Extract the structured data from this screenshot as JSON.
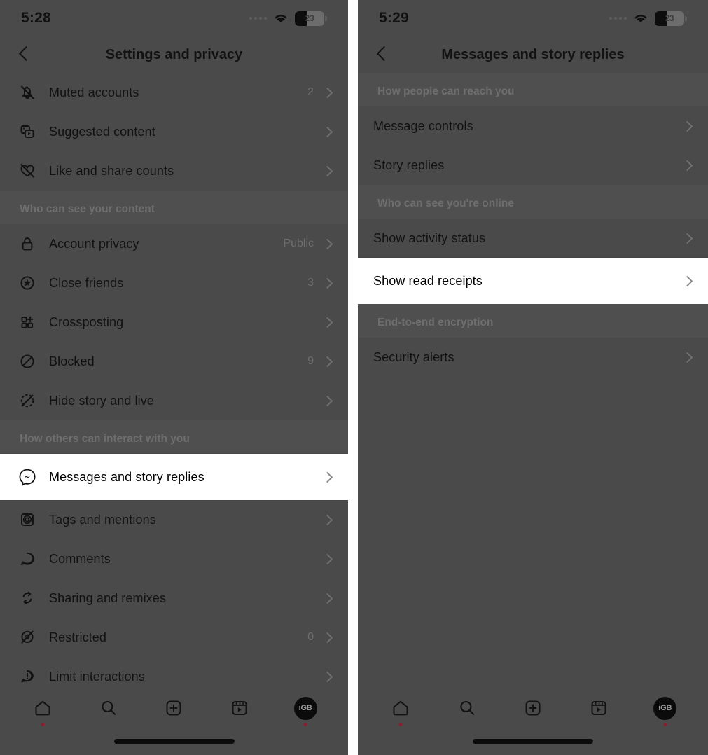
{
  "left_phone": {
    "status_bar": {
      "time": "5:28",
      "battery_level": "23",
      "wifi_icon": "wifi-icon",
      "signal_icon": "signal-dots-icon"
    },
    "header": {
      "back_icon": "back-chevron-icon",
      "title": "Settings and privacy"
    },
    "groups": [
      {
        "header": null,
        "rows": [
          {
            "icon": "muted-bell-icon",
            "label": "Muted accounts",
            "value": "2",
            "highlighted": false
          },
          {
            "icon": "suggested-content-icon",
            "label": "Suggested content",
            "value": "",
            "highlighted": false
          },
          {
            "icon": "heart-slash-icon",
            "label": "Like and share counts",
            "value": "",
            "highlighted": false
          }
        ]
      },
      {
        "header": "Who can see your content",
        "rows": [
          {
            "icon": "lock-icon",
            "label": "Account privacy",
            "value": "Public",
            "highlighted": false
          },
          {
            "icon": "close-friends-star-icon",
            "label": "Close friends",
            "value": "3",
            "highlighted": false
          },
          {
            "icon": "crossposting-grid-icon",
            "label": "Crossposting",
            "value": "",
            "highlighted": false
          },
          {
            "icon": "blocked-circle-slash-icon",
            "label": "Blocked",
            "value": "9",
            "highlighted": false
          },
          {
            "icon": "hide-story-icon",
            "label": "Hide story and live",
            "value": "",
            "highlighted": false
          }
        ]
      },
      {
        "header": "How others can interact with you",
        "rows": [
          {
            "icon": "messenger-icon",
            "label": "Messages and story replies",
            "value": "",
            "highlighted": true
          },
          {
            "icon": "at-mention-icon",
            "label": "Tags and mentions",
            "value": "",
            "highlighted": false
          },
          {
            "icon": "comment-bubble-icon",
            "label": "Comments",
            "value": "",
            "highlighted": false
          },
          {
            "icon": "sharing-remix-icon",
            "label": "Sharing and remixes",
            "value": "",
            "highlighted": false
          },
          {
            "icon": "restricted-icon",
            "label": "Restricted",
            "value": "0",
            "highlighted": false
          },
          {
            "icon": "limit-interactions-icon",
            "label": "Limit interactions",
            "value": "",
            "highlighted": false
          }
        ]
      }
    ],
    "tabbar": {
      "items": [
        {
          "icon": "home-icon",
          "has_dot": true
        },
        {
          "icon": "search-icon",
          "has_dot": false
        },
        {
          "icon": "create-plus-icon",
          "has_dot": false
        },
        {
          "icon": "reels-icon",
          "has_dot": false
        },
        {
          "icon": "profile-avatar",
          "has_dot": true,
          "avatar_text": "iGB"
        }
      ]
    }
  },
  "right_phone": {
    "status_bar": {
      "time": "5:29",
      "battery_level": "23",
      "wifi_icon": "wifi-icon",
      "signal_icon": "signal-dots-icon"
    },
    "header": {
      "back_icon": "back-chevron-icon",
      "title": "Messages and story replies"
    },
    "groups": [
      {
        "header": "How people can reach you",
        "rows": [
          {
            "label": "Message controls",
            "value": "",
            "highlighted": false
          },
          {
            "label": "Story replies",
            "value": "",
            "highlighted": false
          }
        ]
      },
      {
        "header": "Who can see you're online",
        "rows": [
          {
            "label": "Show activity status",
            "value": "",
            "highlighted": false
          },
          {
            "label": "Show read receipts",
            "value": "",
            "highlighted": true
          }
        ]
      },
      {
        "header": "End-to-end encryption",
        "rows": [
          {
            "label": "Security alerts",
            "value": "",
            "highlighted": false
          }
        ]
      }
    ],
    "tabbar": {
      "items": [
        {
          "icon": "home-icon",
          "has_dot": true
        },
        {
          "icon": "search-icon",
          "has_dot": false
        },
        {
          "icon": "create-plus-icon",
          "has_dot": false
        },
        {
          "icon": "reels-icon",
          "has_dot": false
        },
        {
          "icon": "profile-avatar",
          "has_dot": true,
          "avatar_text": "iGB"
        }
      ]
    }
  },
  "colors": {
    "dim_background": "#4a4a4a",
    "section_background": "#4f4f4f",
    "highlight_background": "#ffffff",
    "text_primary": "#121212",
    "text_muted": "#6e6e6e",
    "notification_dot": "#8b1e2d"
  }
}
